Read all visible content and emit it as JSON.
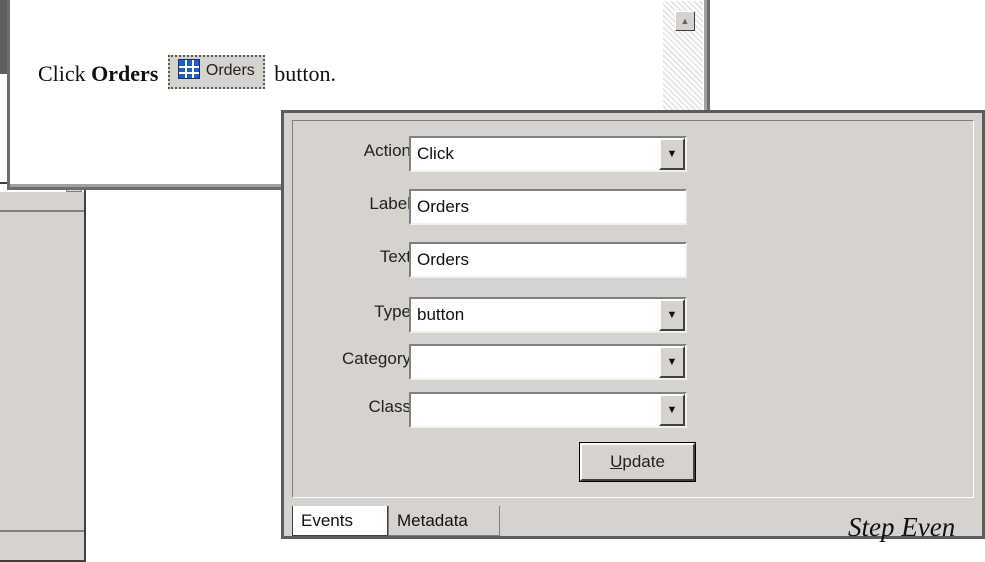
{
  "instruction": {
    "prefix": "Click ",
    "bold": "Orders",
    "button_label": "Orders",
    "suffix": " button."
  },
  "icons": {
    "scroll_up": "▲",
    "dropdown": "▼",
    "button_icon": "grid-table-icon"
  },
  "form": {
    "action": {
      "label": "Action",
      "value": "Click"
    },
    "label": {
      "label": "Label",
      "value": "Orders"
    },
    "text": {
      "label": "Text",
      "value": "Orders"
    },
    "type": {
      "label": "Type",
      "value": "button"
    },
    "category": {
      "label": "Category",
      "value": ""
    },
    "class": {
      "label": "Class",
      "value": ""
    },
    "update_button": "Update",
    "update_button_rest": "pdate",
    "update_button_accel": "U"
  },
  "tabs": [
    {
      "label": "Events",
      "active": true
    },
    {
      "label": "Metadata",
      "active": false
    }
  ],
  "caption": "Step Even",
  "colors": {
    "panel_bg": "#d6d3ce",
    "button_icon_blue": "#1f5fc2"
  }
}
